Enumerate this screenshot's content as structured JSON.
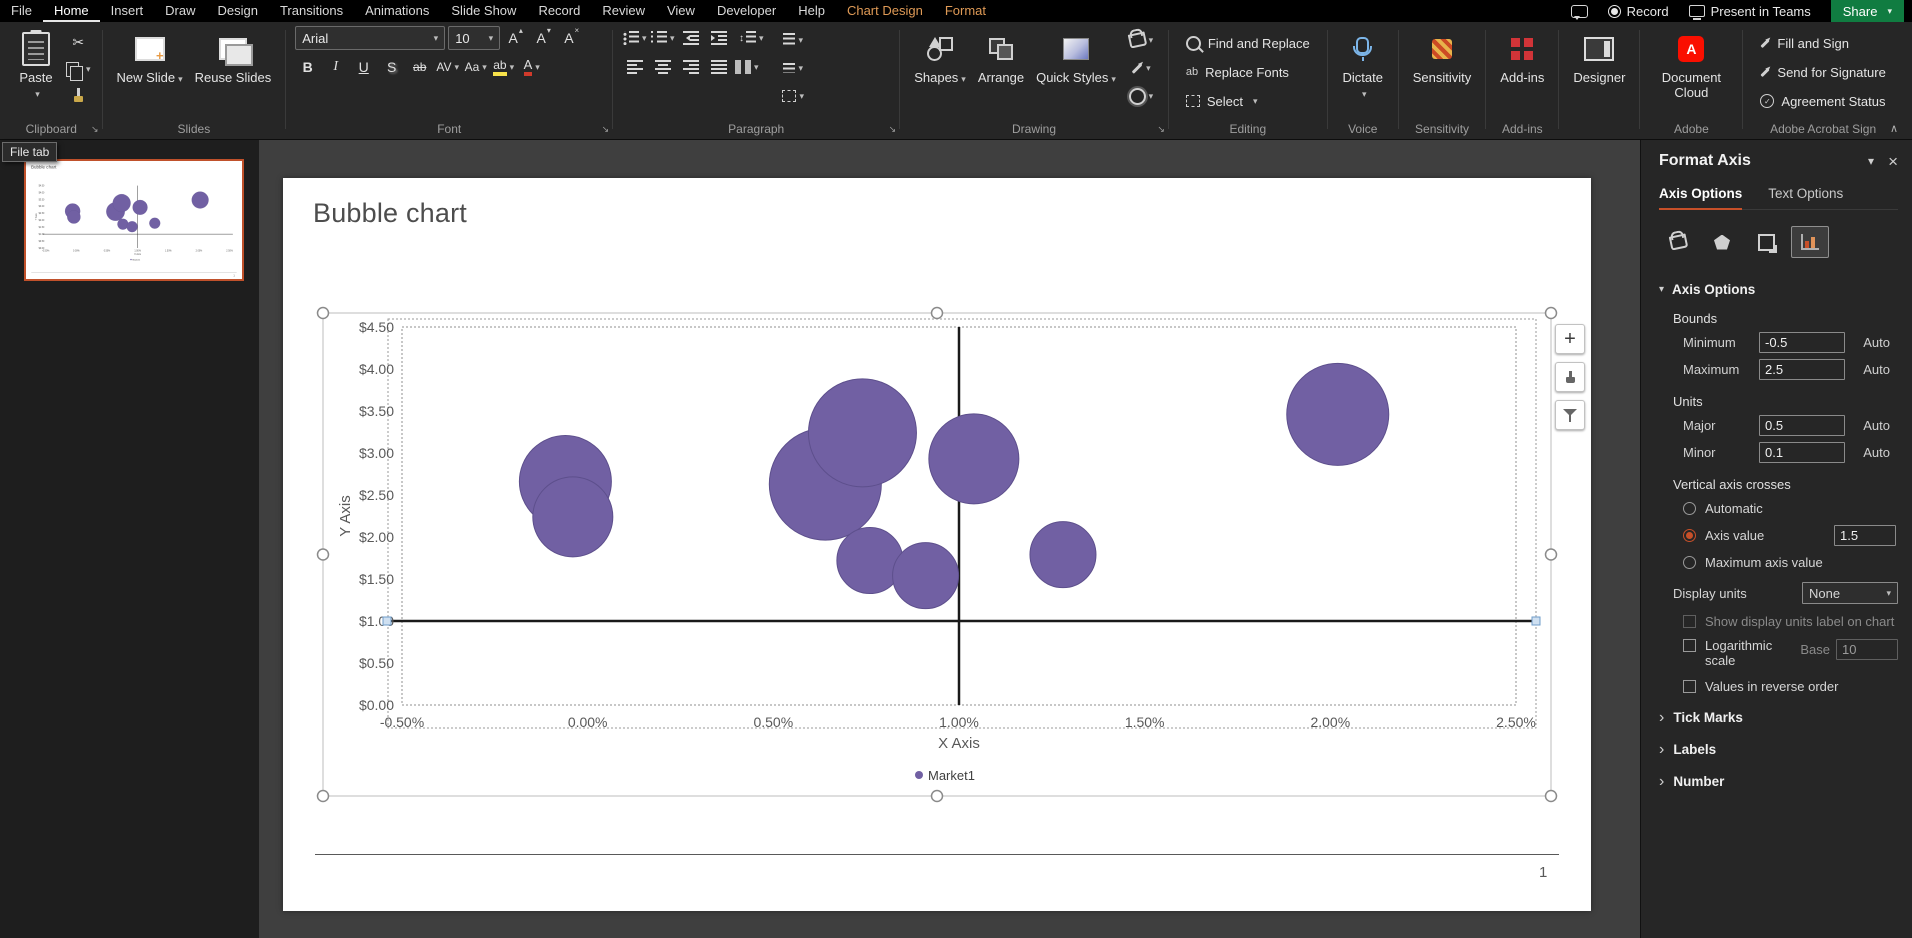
{
  "titlebar": {
    "menus": [
      "File",
      "Home",
      "Insert",
      "Draw",
      "Design",
      "Transitions",
      "Animations",
      "Slide Show",
      "Record",
      "Review",
      "View",
      "Developer",
      "Help"
    ],
    "contextual_menus": [
      "Chart Design",
      "Format"
    ],
    "active_menu": "Home",
    "record_label": "Record",
    "present_label": "Present in Teams",
    "share_label": "Share",
    "accent_contextual": "#DF9A56",
    "share_green": "#107C41"
  },
  "tooltip": {
    "text": "File tab"
  },
  "ribbon": {
    "clipboard": {
      "group": "Clipboard",
      "paste": "Paste"
    },
    "slides": {
      "group": "Slides",
      "new_slide": "New Slide",
      "reuse_slides": "Reuse Slides"
    },
    "font": {
      "group": "Font",
      "font_name": "Arial",
      "font_size": "10"
    },
    "paragraph": {
      "group": "Paragraph"
    },
    "drawing": {
      "group": "Drawing",
      "shapes": "Shapes",
      "arrange": "Arrange",
      "quick_styles": "Quick Styles"
    },
    "editing": {
      "group": "Editing",
      "find": "Find and Replace",
      "replace_fonts": "Replace Fonts",
      "select": "Select"
    },
    "voice": {
      "group": "Voice",
      "dictate": "Dictate"
    },
    "sensitivity": {
      "group": "Sensitivity",
      "button": "Sensitivity"
    },
    "addins": {
      "group": "Add-ins",
      "button": "Add-ins"
    },
    "designer": {
      "button": "Designer"
    },
    "adobe": {
      "group": "Adobe",
      "document_cloud": "Document Cloud"
    },
    "acrobat_sign": {
      "group": "Adobe Acrobat Sign",
      "fill_and_sign": "Fill and Sign",
      "send_for_signature": "Send for Signature",
      "agreement_status": "Agreement Status"
    }
  },
  "slide": {
    "title": "Bubble chart",
    "page_number": "1"
  },
  "chart_data": {
    "type": "scatter",
    "subtype": "bubble",
    "title": "",
    "xlabel": "X Axis",
    "ylabel": "Y Axis",
    "xlim": [
      -0.5,
      2.5
    ],
    "ylim": [
      0,
      4.5
    ],
    "x_tick_values": [
      -0.5,
      0,
      0.5,
      1,
      1.5,
      2,
      2.5
    ],
    "x_tick_labels": [
      "-0.50%",
      "0.00%",
      "0.50%",
      "1.00%",
      "1.50%",
      "2.00%",
      "2.50%"
    ],
    "y_tick_values": [
      0,
      0.5,
      1,
      1.5,
      2,
      2.5,
      3,
      3.5,
      4,
      4.5
    ],
    "y_tick_labels": [
      "$0.00",
      "$0.50",
      "$1.00",
      "$1.50",
      "$2.00",
      "$2.50",
      "$3.00",
      "$3.50",
      "$4.00",
      "$4.50"
    ],
    "legend": [
      "Market1"
    ],
    "legend_position": "bottom",
    "grid": false,
    "vertical_line_x": 1.0,
    "horizontal_line_y": 1.0,
    "bubble_color": "#7160A3",
    "bubble_stroke": "#5d4f8c",
    "series": [
      {
        "name": "Market1",
        "points": [
          {
            "x": -0.06,
            "y": 2.66,
            "r": 46
          },
          {
            "x": -0.04,
            "y": 2.24,
            "r": 40
          },
          {
            "x": 0.64,
            "y": 2.63,
            "r": 56
          },
          {
            "x": 0.74,
            "y": 3.24,
            "r": 54
          },
          {
            "x": 0.76,
            "y": 1.72,
            "r": 33
          },
          {
            "x": 0.91,
            "y": 1.54,
            "r": 33
          },
          {
            "x": 1.04,
            "y": 2.93,
            "r": 45
          },
          {
            "x": 1.28,
            "y": 1.79,
            "r": 33
          },
          {
            "x": 2.02,
            "y": 3.46,
            "r": 51
          }
        ]
      }
    ]
  },
  "format_axis": {
    "title": "Format Axis",
    "tabs": {
      "axis_options": "Axis Options",
      "text_options": "Text Options"
    },
    "section_axis_options": "Axis Options",
    "auto_label": "Auto",
    "bounds": {
      "label": "Bounds",
      "minimum_label": "Minimum",
      "minimum_value": "-0.5",
      "maximum_label": "Maximum",
      "maximum_value": "2.5"
    },
    "units": {
      "label": "Units",
      "major_label": "Major",
      "major_value": "0.5",
      "minor_label": "Minor",
      "minor_value": "0.1"
    },
    "crosses": {
      "label": "Vertical axis crosses",
      "automatic": "Automatic",
      "axis_value": "Axis value",
      "axis_value_input": "1.5",
      "maximum": "Maximum axis value",
      "selected": "axis_value"
    },
    "display_units": {
      "label": "Display units",
      "value": "None"
    },
    "show_display_units": "Show display units label on chart",
    "logarithmic": {
      "label": "Logarithmic scale",
      "base_label": "Base",
      "base_value": "10"
    },
    "reverse": "Values in reverse order",
    "collapsed_sections": [
      "Tick Marks",
      "Labels",
      "Number"
    ],
    "accent": "#C75029"
  }
}
